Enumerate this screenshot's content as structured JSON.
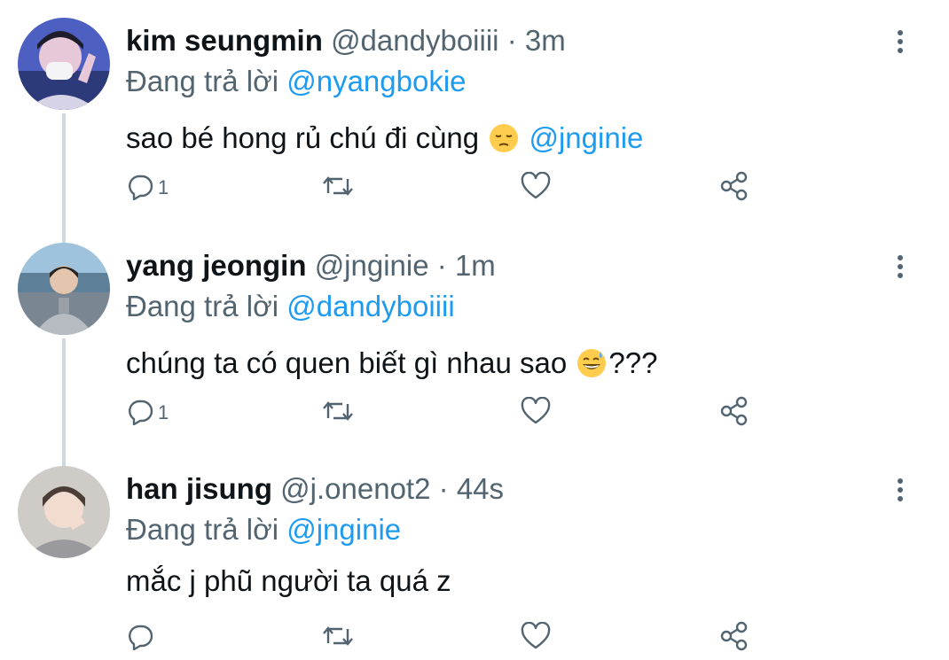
{
  "tweets": [
    {
      "name": "kim seungmin",
      "handle": "@dandyboiiii",
      "time": "3m",
      "reply_prefix": "Đang trả lời",
      "reply_to": "@nyangbokie",
      "text": "sao bé hong rủ chú đi cùng ",
      "text_suffix": "",
      "emoji": "pensive-face",
      "mention": "@jnginie",
      "reply_count": "1",
      "avatar_colors": {
        "bg": "#5a6fd0",
        "accent": "#d9a3e8"
      }
    },
    {
      "name": "yang jeongin",
      "handle": "@jnginie",
      "time": "1m",
      "reply_prefix": "Đang trả lời",
      "reply_to": "@dandyboiiii",
      "text": "chúng ta có quen biết gì nhau sao ",
      "text_suffix": "???",
      "emoji": "grinning-face-with-sweat",
      "mention": "",
      "reply_count": "1",
      "avatar_colors": {
        "bg": "#7fa6c4",
        "accent": "#b9c0c8"
      }
    },
    {
      "name": "han jisung",
      "handle": "@j.onenot2",
      "time": "44s",
      "reply_prefix": "Đang trả lời",
      "reply_to": "@jnginie",
      "text": "mắc j phũ người ta quá z",
      "text_suffix": "",
      "emoji": "",
      "mention": "",
      "reply_count": "",
      "avatar_colors": {
        "bg": "#c9c7c4",
        "accent": "#e8d6cc"
      }
    }
  ],
  "colors": {
    "text": "#0f1419",
    "secondary": "#536471",
    "link": "#1d9bf0",
    "thread_line": "#cfd9de"
  },
  "separator": "·"
}
